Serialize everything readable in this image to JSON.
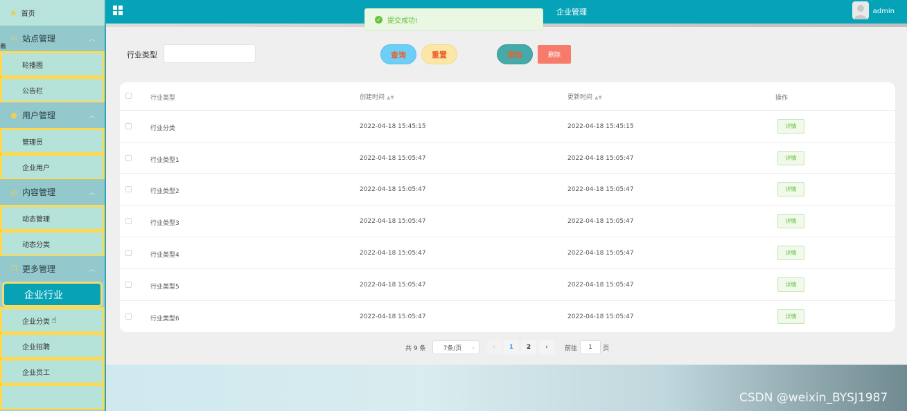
{
  "sidebar": {
    "home": "首页",
    "groups": [
      {
        "label": "站点管理",
        "items": [
          "轮播图",
          "公告栏"
        ]
      },
      {
        "label": "用户管理",
        "items": [
          "管理员",
          "企业用户"
        ]
      },
      {
        "label": "内容管理",
        "items": [
          "动态管理",
          "动态分类"
        ]
      },
      {
        "label": "更多管理",
        "items": [
          "企业行业",
          "企业分类",
          "企业招聘",
          "企业员工"
        ]
      }
    ],
    "active_item": "企业行业"
  },
  "header": {
    "title": "企业管理",
    "user": "admin"
  },
  "toast": {
    "message": "提交成功!"
  },
  "search": {
    "label": "行业类型",
    "value": "",
    "query_label": "查询",
    "reset_label": "重置",
    "add_label": "添加",
    "delete_label": "删除"
  },
  "table": {
    "columns": [
      "行业类型",
      "创建时间",
      "更新时间",
      "操作"
    ],
    "rows": [
      {
        "type": "行业分类",
        "created": "2022-04-18 15:45:15",
        "updated": "2022-04-18 15:45:15",
        "action": "详情"
      },
      {
        "type": "行业类型1",
        "created": "2022-04-18 15:05:47",
        "updated": "2022-04-18 15:05:47",
        "action": "详情"
      },
      {
        "type": "行业类型2",
        "created": "2022-04-18 15:05:47",
        "updated": "2022-04-18 15:05:47",
        "action": "详情"
      },
      {
        "type": "行业类型3",
        "created": "2022-04-18 15:05:47",
        "updated": "2022-04-18 15:05:47",
        "action": "详情"
      },
      {
        "type": "行业类型4",
        "created": "2022-04-18 15:05:47",
        "updated": "2022-04-18 15:05:47",
        "action": "详情"
      },
      {
        "type": "行业类型5",
        "created": "2022-04-18 15:05:47",
        "updated": "2022-04-18 15:05:47",
        "action": "详情"
      },
      {
        "type": "行业类型6",
        "created": "2022-04-18 15:05:47",
        "updated": "2022-04-18 15:05:47",
        "action": "详情"
      }
    ]
  },
  "pagination": {
    "total": "共 9 条",
    "page_size": "7条/页",
    "pages": [
      "1",
      "2"
    ],
    "current": "1",
    "goto_label": "前往",
    "goto_value": "1",
    "page_suffix": "页"
  },
  "watermark": "CSDN @weixin_BYSJ1987",
  "edge_glyph": "看",
  "colors": {
    "topbar": "#06a3b8",
    "active_item": "#08a2b6",
    "submenu_border": "#ffd94f",
    "success": "#67c23a",
    "delete": "#f77b6a"
  },
  "icons": {
    "home": "star-icon",
    "site": "monitor-icon",
    "user": "user-icon",
    "content": "target-icon",
    "more": "copy-icon"
  }
}
